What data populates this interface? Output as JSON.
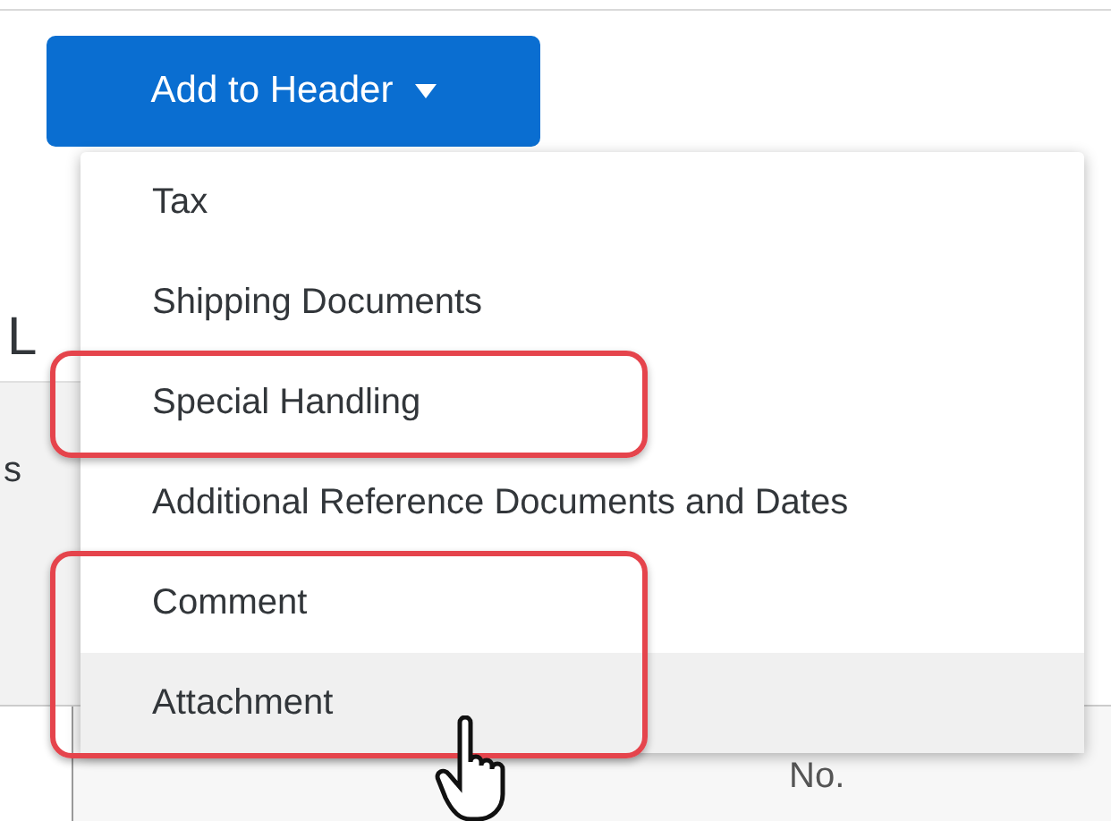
{
  "page": {
    "heading": "L",
    "table_header_cell": "s",
    "table_column": "No."
  },
  "button": {
    "label": "Add to Header",
    "expanded": true
  },
  "menu": {
    "items": [
      {
        "label": "Tax",
        "hovered": false,
        "highlighted": false
      },
      {
        "label": "Shipping Documents",
        "hovered": false,
        "highlighted": false
      },
      {
        "label": "Special Handling",
        "hovered": false,
        "highlighted": true
      },
      {
        "label": "Additional Reference Documents and Dates",
        "hovered": false,
        "highlighted": false
      },
      {
        "label": "Comment",
        "hovered": false,
        "highlighted": true
      },
      {
        "label": "Attachment",
        "hovered": true,
        "highlighted": true
      }
    ]
  }
}
